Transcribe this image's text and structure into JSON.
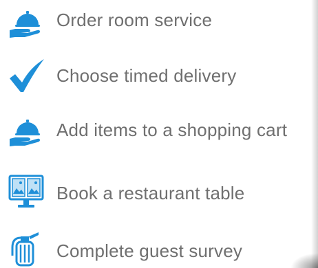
{
  "colors": {
    "icon_blue": "#1e8fd8",
    "text_gray": "#6f6f6f",
    "background": "#ffffff"
  },
  "features": [
    {
      "label": "Order room service",
      "icon": "cloche-tray-icon"
    },
    {
      "label": "Choose timed delivery",
      "icon": "checkmark-icon"
    },
    {
      "label": "Add items to a shopping cart",
      "icon": "cloche-tray-icon"
    },
    {
      "label": "Book a restaurant table",
      "icon": "monitor-gallery-icon"
    },
    {
      "label": "Complete guest survey",
      "icon": "fire-extinguisher-icon"
    }
  ]
}
